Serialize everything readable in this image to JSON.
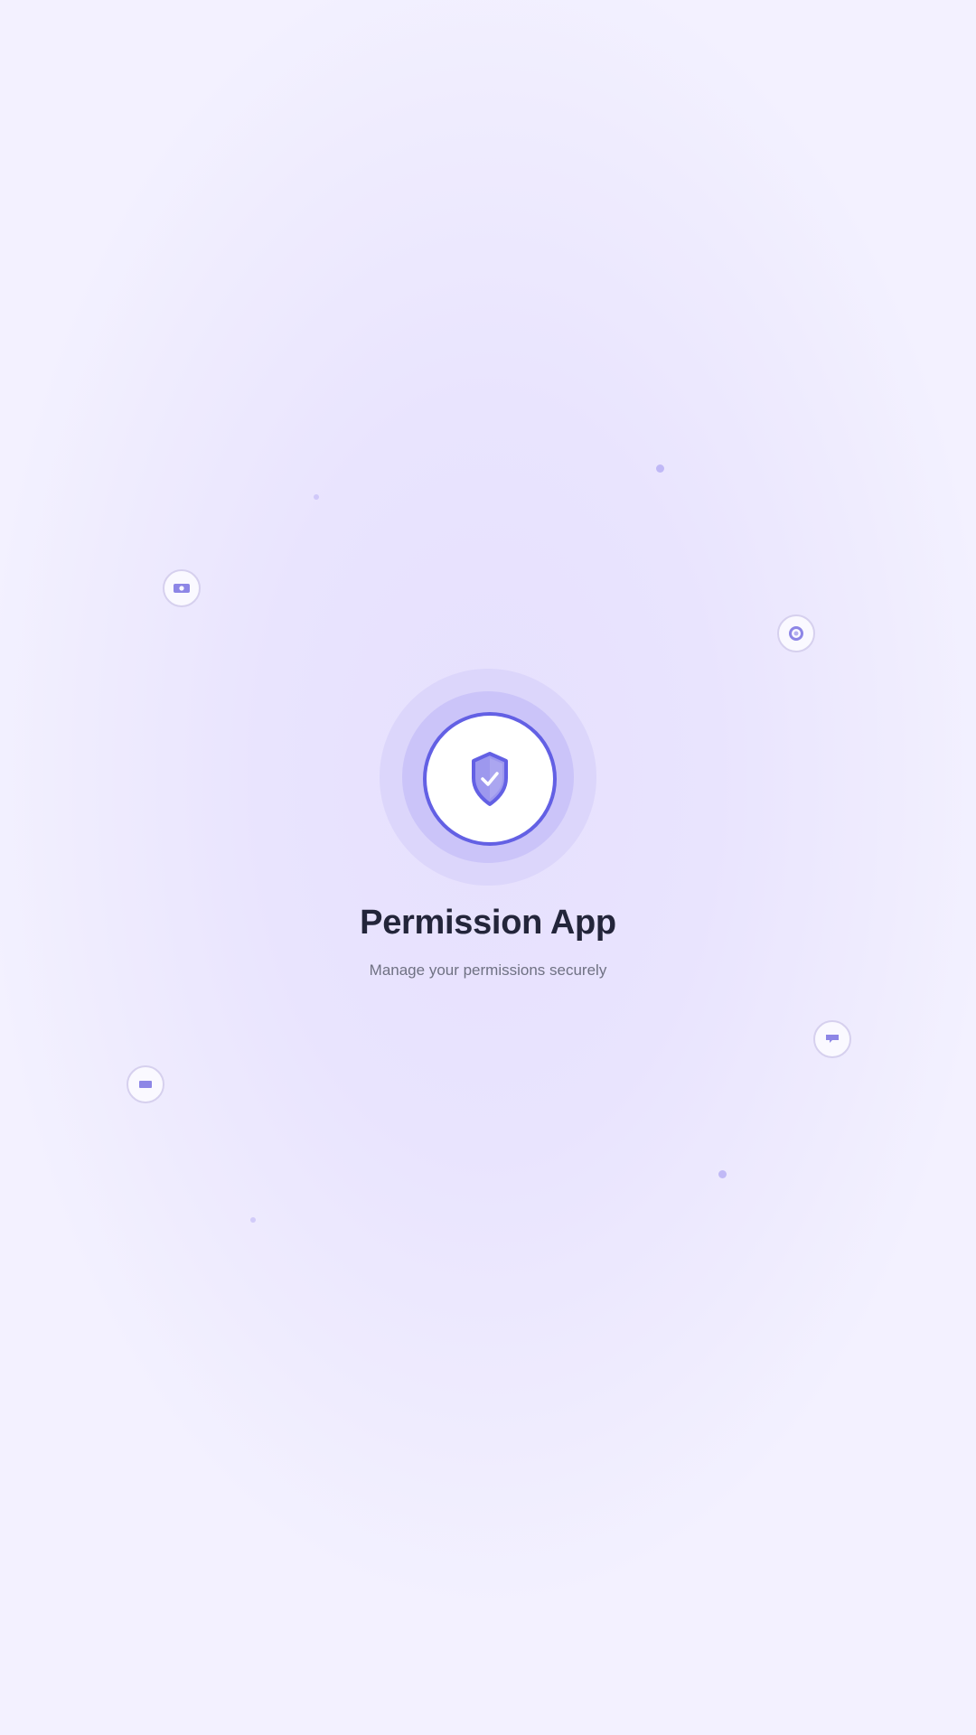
{
  "app": {
    "title": "Permission App",
    "subtitle": "Manage your permissions securely"
  },
  "icons": {
    "logo": "shield-check-icon",
    "floating": [
      "camera-icon",
      "location-icon",
      "chat-icon",
      "card-icon"
    ]
  },
  "colors": {
    "accent": "#6360e4",
    "shield_fill": "#9d98ee",
    "badge_icon": "#8d86e6",
    "title_text": "#23253a",
    "subtitle_text": "#6f7183",
    "background": "#efecfe"
  }
}
